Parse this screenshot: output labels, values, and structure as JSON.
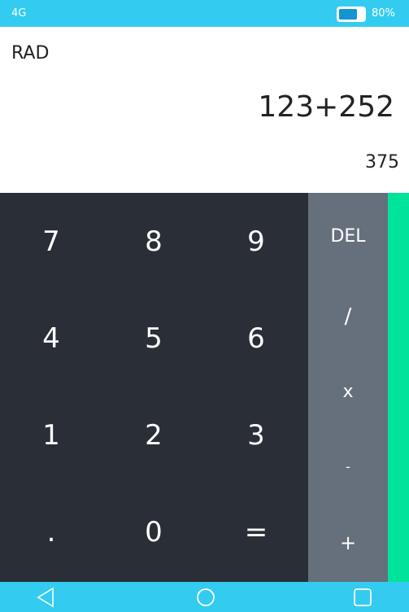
{
  "status_bar": {
    "network": "4G",
    "battery_pct": "80%",
    "battery_level": 0.8
  },
  "display": {
    "mode": "RAD",
    "expression": "123+252",
    "result": "375"
  },
  "keypad": {
    "rows": [
      [
        "7",
        "8",
        "9"
      ],
      [
        "4",
        "5",
        "6"
      ],
      [
        "1",
        "2",
        "3"
      ],
      [
        ".",
        "0",
        "="
      ]
    ]
  },
  "operators": {
    "del": "DEL",
    "divide": "/",
    "multiply": "x",
    "subtract": "-",
    "add": "+"
  },
  "colors": {
    "status_bar": "#33ccf0",
    "keypad_bg": "#2a2e37",
    "operator_bg": "#666f7c",
    "drawer_handle": "#00e39a"
  },
  "nav_bar": {
    "back": "back-icon",
    "home": "home-icon",
    "recents": "recents-icon"
  }
}
